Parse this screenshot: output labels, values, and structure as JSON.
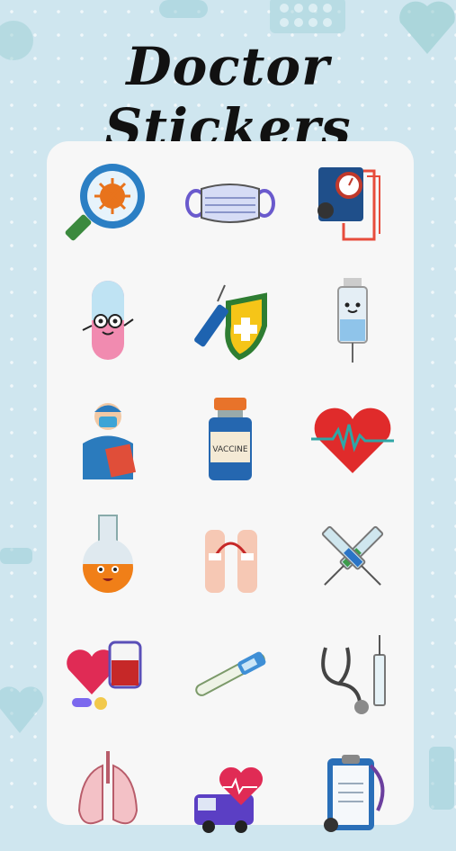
{
  "app": {
    "title": "Doctor Stickers"
  },
  "stickers": [
    {
      "icon": "magnifier-virus-icon"
    },
    {
      "icon": "face-mask-icon"
    },
    {
      "icon": "blood-pressure-monitor-icon"
    },
    {
      "icon": "pill-character-icon"
    },
    {
      "icon": "vaccine-syringe-shield-icon"
    },
    {
      "icon": "syringe-character-icon"
    },
    {
      "icon": "nurse-icon"
    },
    {
      "icon": "vaccine-bottle-icon",
      "label": "VACCINE"
    },
    {
      "icon": "heartbeat-heart-icon"
    },
    {
      "icon": "flask-character-icon"
    },
    {
      "icon": "blood-transfusion-arms-icon"
    },
    {
      "icon": "crossed-syringes-icon"
    },
    {
      "icon": "heart-blood-bag-pills-icon"
    },
    {
      "icon": "thermometer-icon"
    },
    {
      "icon": "stethoscope-syringe-icon"
    },
    {
      "icon": "lungs-icon"
    },
    {
      "icon": "ambulance-heart-icon"
    },
    {
      "icon": "clipboard-stethoscope-icon"
    }
  ]
}
